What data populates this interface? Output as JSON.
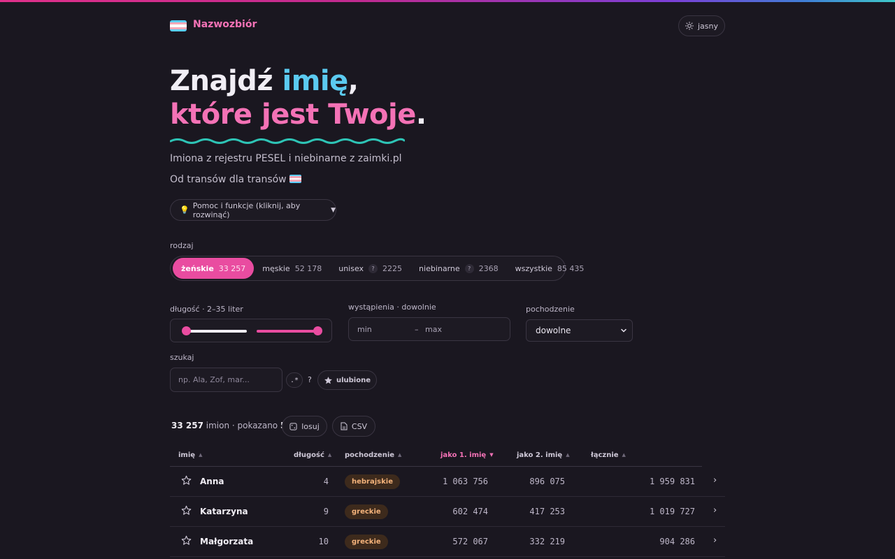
{
  "header": {
    "brand": "Nazwozbiór",
    "theme_label": "jasny"
  },
  "hero": {
    "line1_a": "Znajdź ",
    "line1_b": "imię",
    "line1_c": ",",
    "line2_a": "które jest Twoje",
    "line2_b": ".",
    "sub1": "Imiona z rejestru PESEL i niebinarne z zaimki.pl",
    "sub2": "Od transów dla transów"
  },
  "help": {
    "icon": "💡",
    "label": "Pomoc i funkcje (kliknij, aby rozwinąć)",
    "arrow": "▼"
  },
  "gender": {
    "label": "rodzaj",
    "items": [
      {
        "label": "żeńskie",
        "count": "33 257",
        "active": true
      },
      {
        "label": "męskie",
        "count": "52 178"
      },
      {
        "label": "unisex",
        "count": "2225",
        "help": "?"
      },
      {
        "label": "niebinarne",
        "count": "2368",
        "help": "?"
      },
      {
        "label": "wszystkie",
        "count": "85 435"
      }
    ]
  },
  "filters": {
    "length_label": "długość · 2–35 liter",
    "length_min": 2,
    "length_max": 35,
    "occurrences_label": "wystąpienia · dowolnie",
    "min_placeholder": "min",
    "dash": "–",
    "max_placeholder": "max",
    "origin_label": "pochodzenie",
    "origin_value": "dowolne"
  },
  "search": {
    "label": "szukaj",
    "placeholder": "np. Ala, Zof, mar...",
    "regex_label": ".*",
    "help": "?",
    "favorites_label": "ulubione"
  },
  "results": {
    "total": "33 257",
    "imion": " imion · pokazano ",
    "shown": "50",
    "random_label": "losuj",
    "csv_label": "CSV"
  },
  "table": {
    "columns": {
      "name": "imię",
      "length": "długość",
      "origin": "pochodzenie",
      "first": "jako 1. imię",
      "second": "jako 2. imię",
      "total": "łącznie"
    },
    "rows": [
      {
        "name": "Anna",
        "length": "4",
        "origin": "hebrajskie",
        "first": "1 063 756",
        "second": "896 075",
        "total": "1 959 831"
      },
      {
        "name": "Katarzyna",
        "length": "9",
        "origin": "greckie",
        "first": "602 474",
        "second": "417 253",
        "total": "1 019 727"
      },
      {
        "name": "Małgorzata",
        "length": "10",
        "origin": "greckie",
        "first": "572 067",
        "second": "332 219",
        "total": "904 286"
      }
    ],
    "go_label": "›"
  },
  "colors": {
    "accent": "#e94ca0",
    "blue": "#5bcaf0",
    "wave": "#2ec4b6"
  }
}
